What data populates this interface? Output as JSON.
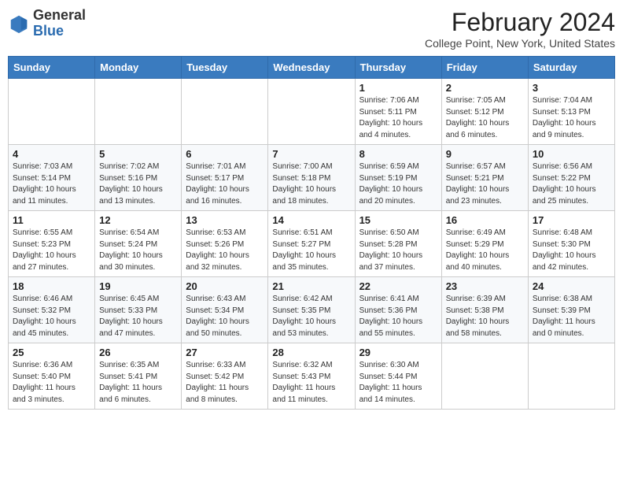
{
  "header": {
    "logo_general": "General",
    "logo_blue": "Blue",
    "month_title": "February 2024",
    "location": "College Point, New York, United States"
  },
  "weekdays": [
    "Sunday",
    "Monday",
    "Tuesday",
    "Wednesday",
    "Thursday",
    "Friday",
    "Saturday"
  ],
  "weeks": [
    [
      {
        "day": "",
        "detail": ""
      },
      {
        "day": "",
        "detail": ""
      },
      {
        "day": "",
        "detail": ""
      },
      {
        "day": "",
        "detail": ""
      },
      {
        "day": "1",
        "detail": "Sunrise: 7:06 AM\nSunset: 5:11 PM\nDaylight: 10 hours\nand 4 minutes."
      },
      {
        "day": "2",
        "detail": "Sunrise: 7:05 AM\nSunset: 5:12 PM\nDaylight: 10 hours\nand 6 minutes."
      },
      {
        "day": "3",
        "detail": "Sunrise: 7:04 AM\nSunset: 5:13 PM\nDaylight: 10 hours\nand 9 minutes."
      }
    ],
    [
      {
        "day": "4",
        "detail": "Sunrise: 7:03 AM\nSunset: 5:14 PM\nDaylight: 10 hours\nand 11 minutes."
      },
      {
        "day": "5",
        "detail": "Sunrise: 7:02 AM\nSunset: 5:16 PM\nDaylight: 10 hours\nand 13 minutes."
      },
      {
        "day": "6",
        "detail": "Sunrise: 7:01 AM\nSunset: 5:17 PM\nDaylight: 10 hours\nand 16 minutes."
      },
      {
        "day": "7",
        "detail": "Sunrise: 7:00 AM\nSunset: 5:18 PM\nDaylight: 10 hours\nand 18 minutes."
      },
      {
        "day": "8",
        "detail": "Sunrise: 6:59 AM\nSunset: 5:19 PM\nDaylight: 10 hours\nand 20 minutes."
      },
      {
        "day": "9",
        "detail": "Sunrise: 6:57 AM\nSunset: 5:21 PM\nDaylight: 10 hours\nand 23 minutes."
      },
      {
        "day": "10",
        "detail": "Sunrise: 6:56 AM\nSunset: 5:22 PM\nDaylight: 10 hours\nand 25 minutes."
      }
    ],
    [
      {
        "day": "11",
        "detail": "Sunrise: 6:55 AM\nSunset: 5:23 PM\nDaylight: 10 hours\nand 27 minutes."
      },
      {
        "day": "12",
        "detail": "Sunrise: 6:54 AM\nSunset: 5:24 PM\nDaylight: 10 hours\nand 30 minutes."
      },
      {
        "day": "13",
        "detail": "Sunrise: 6:53 AM\nSunset: 5:26 PM\nDaylight: 10 hours\nand 32 minutes."
      },
      {
        "day": "14",
        "detail": "Sunrise: 6:51 AM\nSunset: 5:27 PM\nDaylight: 10 hours\nand 35 minutes."
      },
      {
        "day": "15",
        "detail": "Sunrise: 6:50 AM\nSunset: 5:28 PM\nDaylight: 10 hours\nand 37 minutes."
      },
      {
        "day": "16",
        "detail": "Sunrise: 6:49 AM\nSunset: 5:29 PM\nDaylight: 10 hours\nand 40 minutes."
      },
      {
        "day": "17",
        "detail": "Sunrise: 6:48 AM\nSunset: 5:30 PM\nDaylight: 10 hours\nand 42 minutes."
      }
    ],
    [
      {
        "day": "18",
        "detail": "Sunrise: 6:46 AM\nSunset: 5:32 PM\nDaylight: 10 hours\nand 45 minutes."
      },
      {
        "day": "19",
        "detail": "Sunrise: 6:45 AM\nSunset: 5:33 PM\nDaylight: 10 hours\nand 47 minutes."
      },
      {
        "day": "20",
        "detail": "Sunrise: 6:43 AM\nSunset: 5:34 PM\nDaylight: 10 hours\nand 50 minutes."
      },
      {
        "day": "21",
        "detail": "Sunrise: 6:42 AM\nSunset: 5:35 PM\nDaylight: 10 hours\nand 53 minutes."
      },
      {
        "day": "22",
        "detail": "Sunrise: 6:41 AM\nSunset: 5:36 PM\nDaylight: 10 hours\nand 55 minutes."
      },
      {
        "day": "23",
        "detail": "Sunrise: 6:39 AM\nSunset: 5:38 PM\nDaylight: 10 hours\nand 58 minutes."
      },
      {
        "day": "24",
        "detail": "Sunrise: 6:38 AM\nSunset: 5:39 PM\nDaylight: 11 hours\nand 0 minutes."
      }
    ],
    [
      {
        "day": "25",
        "detail": "Sunrise: 6:36 AM\nSunset: 5:40 PM\nDaylight: 11 hours\nand 3 minutes."
      },
      {
        "day": "26",
        "detail": "Sunrise: 6:35 AM\nSunset: 5:41 PM\nDaylight: 11 hours\nand 6 minutes."
      },
      {
        "day": "27",
        "detail": "Sunrise: 6:33 AM\nSunset: 5:42 PM\nDaylight: 11 hours\nand 8 minutes."
      },
      {
        "day": "28",
        "detail": "Sunrise: 6:32 AM\nSunset: 5:43 PM\nDaylight: 11 hours\nand 11 minutes."
      },
      {
        "day": "29",
        "detail": "Sunrise: 6:30 AM\nSunset: 5:44 PM\nDaylight: 11 hours\nand 14 minutes."
      },
      {
        "day": "",
        "detail": ""
      },
      {
        "day": "",
        "detail": ""
      }
    ]
  ]
}
